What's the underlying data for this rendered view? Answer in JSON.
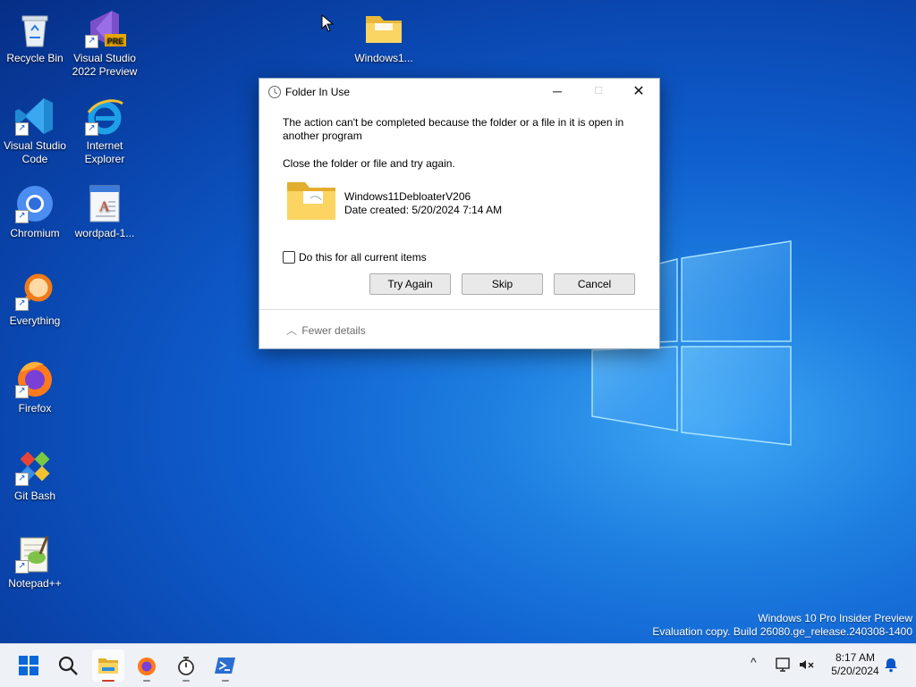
{
  "desktop": {
    "icons": [
      {
        "label": "Recycle Bin"
      },
      {
        "label": "Visual Studio 2022 Preview",
        "badge": "PRE"
      },
      {
        "label": "Windows1..."
      },
      {
        "label": "Visual Studio Code"
      },
      {
        "label": "Internet Explorer"
      },
      {
        "label": "Chromium"
      },
      {
        "label": "wordpad-1..."
      },
      {
        "label": "Everything"
      },
      {
        "label": "Firefox"
      },
      {
        "label": "Git Bash"
      },
      {
        "label": "Notepad++"
      }
    ]
  },
  "dialog": {
    "title": "Folder In Use",
    "controls": {
      "minimize": "─",
      "maximize": "☐",
      "close": "✕"
    },
    "message": "The action can't be completed because the folder or a file in it is open in another program",
    "instruction": "Close the folder or file and try again.",
    "file_name": "Windows11DebloaterV206",
    "file_date": "Date created: 5/20/2024 7:14 AM",
    "checkbox_label": "Do this for all current items",
    "checkbox_checked": false,
    "buttons": {
      "try_again": "Try Again",
      "skip": "Skip",
      "cancel": "Cancel"
    },
    "fewer_details": "Fewer details",
    "fewer_chevron": "︿"
  },
  "watermark": {
    "line1": "Windows 10 Pro Insider Preview",
    "line2": "Evaluation copy. Build 26080.ge_release.240308-1400"
  },
  "taskbar": {
    "icons": [
      "windows-start-icon",
      "search-icon",
      "file-explorer-icon",
      "firefox-icon",
      "stopwatch-icon",
      "powershell-icon"
    ],
    "tray_chevron": "^",
    "clock_time": "8:17 AM",
    "clock_date": "5/20/2024"
  },
  "colors": {
    "accent": "#0a67d9",
    "taskbar": "#eef1f6",
    "dialog_bg": "#ffffff"
  }
}
